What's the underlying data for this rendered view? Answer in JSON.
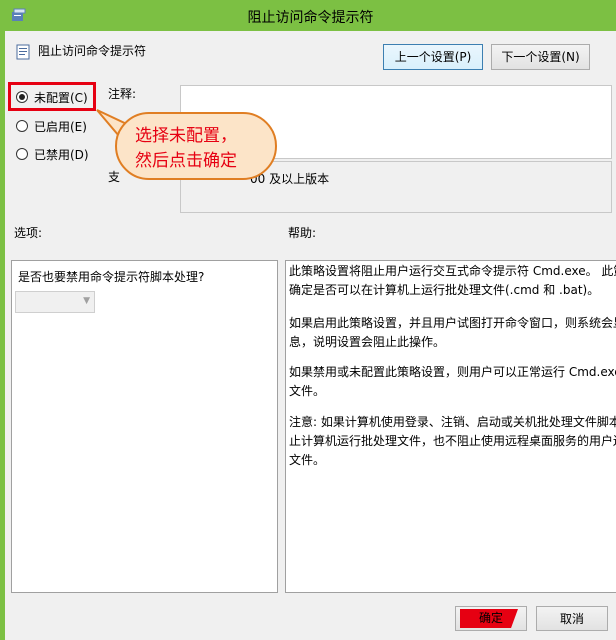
{
  "window": {
    "title": "阻止访问命令提示符"
  },
  "header": {
    "policy_name": "阻止访问命令提示符",
    "prev_label": "上一个设置(P)",
    "next_label": "下一个设置(N)"
  },
  "state_options": [
    {
      "label": "未配置(C)",
      "selected": true
    },
    {
      "label": "已启用(E)",
      "selected": false
    },
    {
      "label": "已禁用(D)",
      "selected": false
    }
  ],
  "comment": {
    "label": "注释:",
    "value": ""
  },
  "supported": {
    "label": "支",
    "value": "00 及以上版本"
  },
  "callout": {
    "line1": "选择未配置，",
    "line2": "然后点击确定"
  },
  "options": {
    "label": "选项:",
    "question": "是否也要禁用命令提示符脚本处理?",
    "select_value": ""
  },
  "help": {
    "label": "帮助:",
    "paragraphs": [
      [
        "此策略设置将阻止用户运行交互式命令提示符 Cmd.exe。 此策",
        "确定是否可以在计算机上运行批处理文件(.cmd 和 .bat)。"
      ],
      [
        "如果启用此策略设置，并且用户试图打开命令窗口，则系统会显",
        "息，说明设置会阻止此操作。"
      ],
      [
        "如果禁用或未配置此策略设置，则用户可以正常运行 Cmd.exe",
        "文件。"
      ],
      [
        "注意: 如果计算机使用登录、注销、启动或关机批处理文件脚本",
        "止计算机运行批处理文件，也不阻止使用远程桌面服务的用户还",
        "文件。"
      ]
    ]
  },
  "footer": {
    "ok_label": "确定",
    "cancel_label": "取消"
  },
  "colors": {
    "title_bar": "#7cc043",
    "highlight": "#e60012",
    "callout_fill": "#fce4c8",
    "callout_border": "#e07e23"
  }
}
